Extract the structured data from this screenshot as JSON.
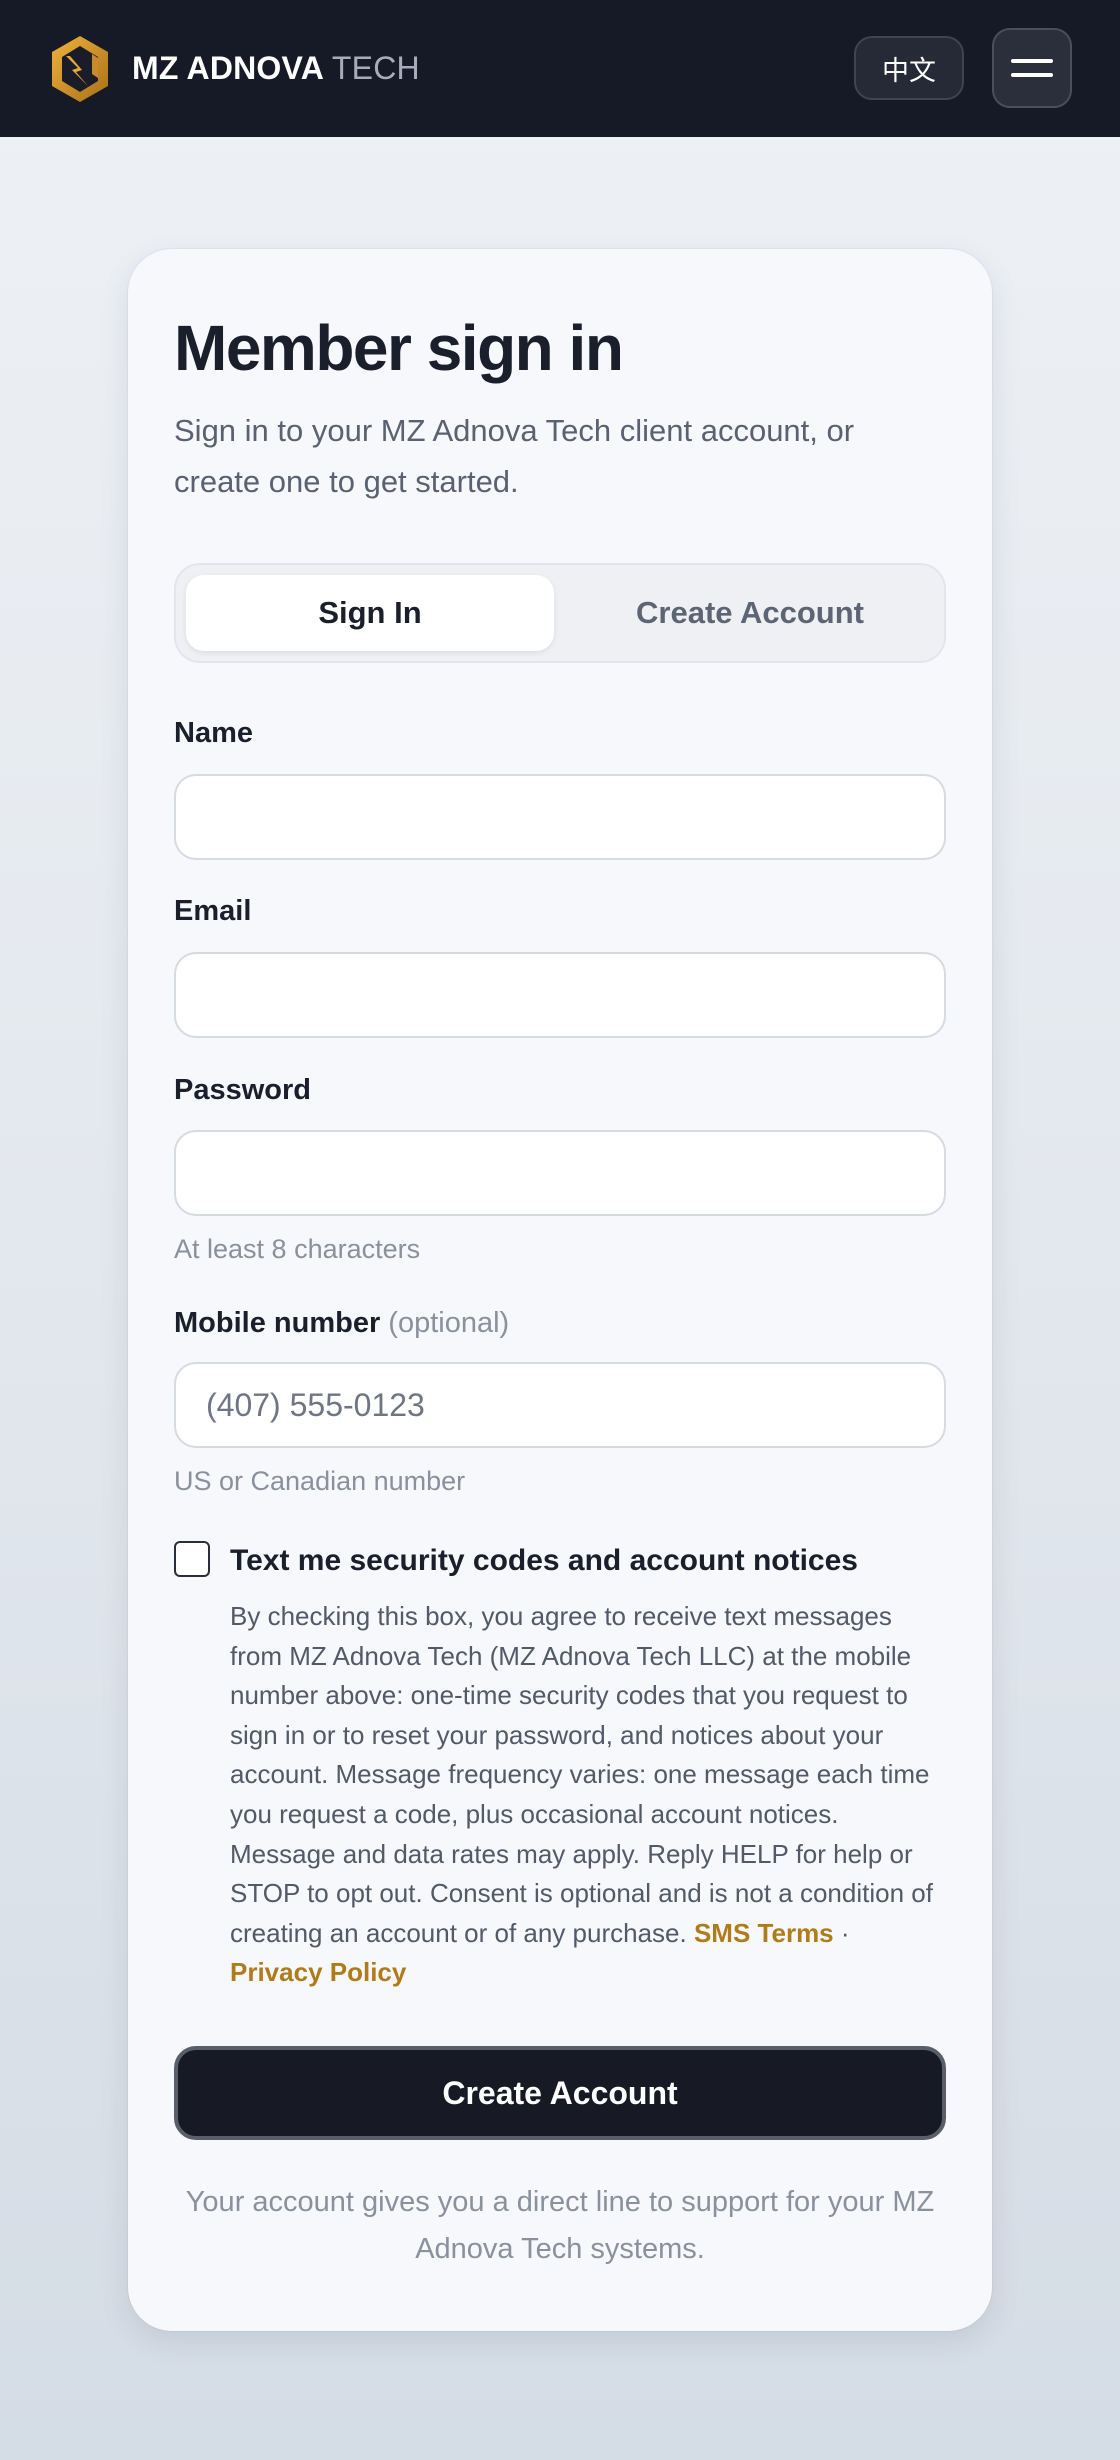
{
  "header": {
    "brand_bold": "MZ ADNOVA",
    "brand_light": "TECH",
    "language_button": "中文",
    "logo_icon": "hexagon-bolt-logo",
    "menu_icon": "hamburger-icon"
  },
  "card": {
    "title": "Member sign in",
    "subtitle": "Sign in to your MZ Adnova Tech client account, or create one to get started.",
    "tabs": [
      {
        "label": "Sign In",
        "active": true
      },
      {
        "label": "Create Account",
        "active": false
      }
    ],
    "form": {
      "name_label": "Name",
      "name_value": "",
      "email_label": "Email",
      "email_value": "",
      "password_label": "Password",
      "password_value": "",
      "password_hint": "At least 8 characters",
      "mobile_label": "Mobile number",
      "mobile_optional": "(optional)",
      "mobile_placeholder": "(407) 555-0123",
      "mobile_hint": "US or Canadian number"
    },
    "consent": {
      "checked": false,
      "title": "Text me security codes and account notices",
      "body": "By checking this box, you agree to receive text messages from MZ Adnova Tech (MZ Adnova Tech LLC) at the mobile number above: one-time security codes that you request to sign in or to reset your password, and notices about your account. Message frequency varies: one message each time you request a code, plus occasional account notices. Message and data rates may apply. Reply HELP for help or STOP to opt out. Consent is optional and is not a condition of creating an account or of any purchase.",
      "sms_terms_link": "SMS Terms",
      "separator": "·",
      "privacy_link": "Privacy Policy"
    },
    "submit_button": "Create Account",
    "footnote": "Your account gives you a direct line to support for your MZ Adnova Tech systems."
  },
  "colors": {
    "topbar": "#161a26",
    "accent_gold": "#b07b1a",
    "button_dark": "#171a24"
  }
}
